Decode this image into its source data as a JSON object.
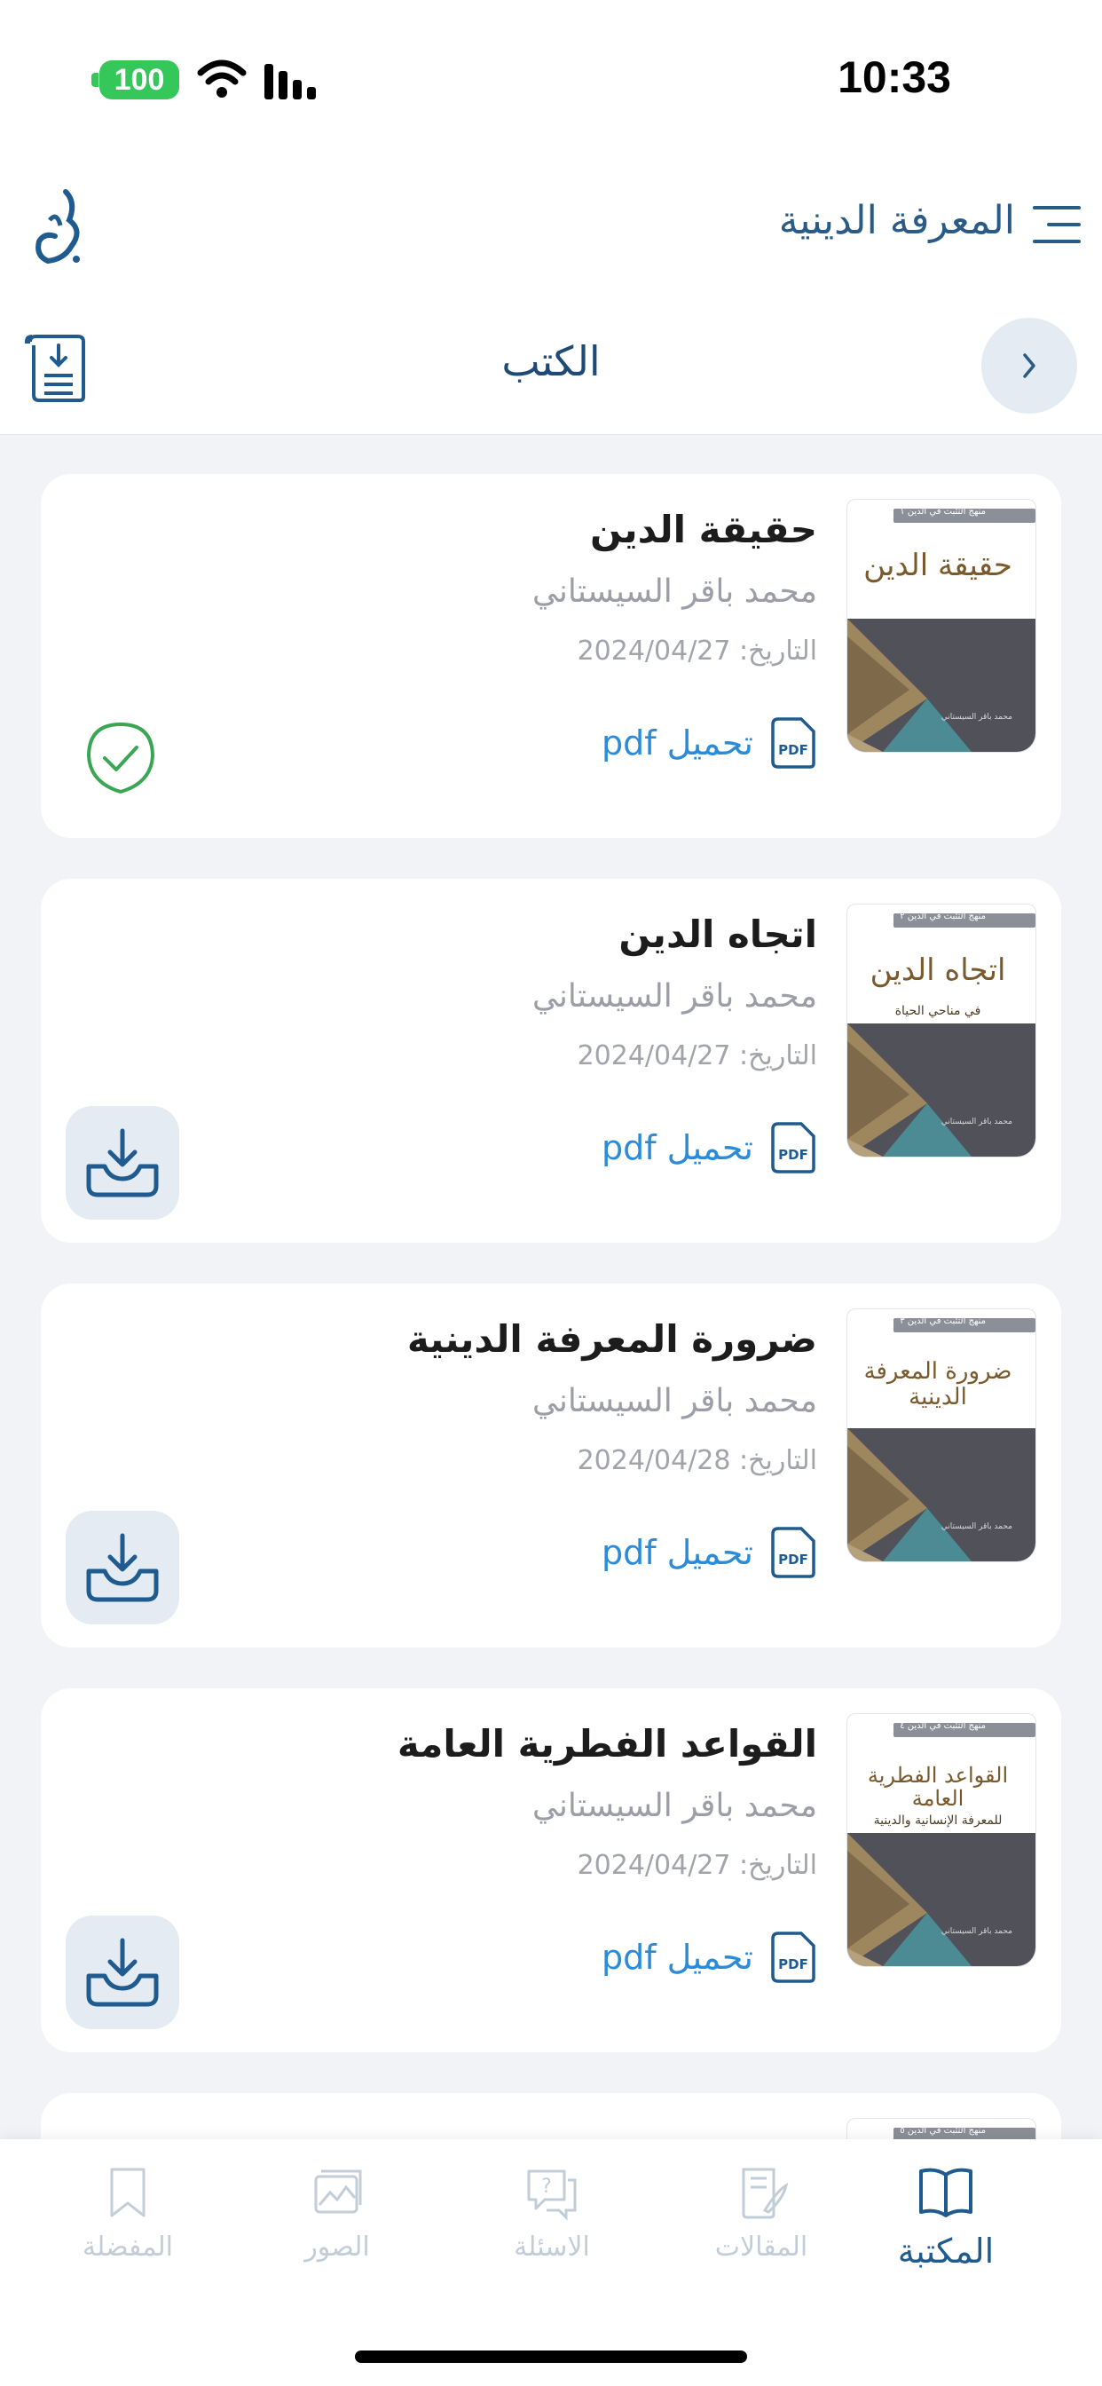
{
  "status_bar": {
    "battery": "100",
    "time": "10:33"
  },
  "header": {
    "app_title": "المعرفة الدينية",
    "section_title": "الكتب"
  },
  "books": [
    {
      "title": "حقيقة الدين",
      "author": "محمد باقر السيستاني",
      "date": "التاريخ: 2024/04/27",
      "pdf_label": "تحميل pdf",
      "cover_title": "حقيقة الدين",
      "cover_subtitle": "",
      "cover_tag": "منهج التثبت في الدين ١",
      "cover_author": "محمد باقر السيستاني",
      "downloaded": true
    },
    {
      "title": "اتجاه الدين",
      "author": "محمد باقر السيستاني",
      "date": "التاريخ: 2024/04/27",
      "pdf_label": "تحميل pdf",
      "cover_title": "اتجاه الدين",
      "cover_subtitle": "في مناحي الحياة",
      "cover_tag": "منهج التثبت في الدين ٢",
      "cover_author": "محمد باقر السيستاني",
      "downloaded": false
    },
    {
      "title": "ضرورة المعرفة الدينية",
      "author": "محمد باقر السيستاني",
      "date": "التاريخ: 2024/04/28",
      "pdf_label": "تحميل pdf",
      "cover_title": "ضرورة المعرفة الدينية",
      "cover_subtitle": "",
      "cover_tag": "منهج التثبت في الدين ٣",
      "cover_author": "محمد باقر السيستاني",
      "downloaded": false
    },
    {
      "title": "القواعد الفطرية العامة",
      "author": "محمد باقر السيستاني",
      "date": "التاريخ: 2024/04/27",
      "pdf_label": "تحميل pdf",
      "cover_title": "القواعد الفطرية العامة",
      "cover_subtitle": "للمعرفة الإنسانية والدينية",
      "cover_tag": "منهج التثبت في الدين ٤",
      "cover_author": "محمد باقر السيستاني",
      "downloaded": false
    },
    {
      "title": "",
      "author": "",
      "date": "",
      "pdf_label": "",
      "cover_title": "",
      "cover_subtitle": "",
      "cover_tag": "منهج التثبت في الدين ٥",
      "cover_author": "",
      "downloaded": false
    }
  ],
  "tabs": [
    {
      "label": "المكتبة",
      "icon": "book-open-icon",
      "active": true
    },
    {
      "label": "المقالات",
      "icon": "articles-icon",
      "active": false
    },
    {
      "label": "الاسئلة",
      "icon": "questions-icon",
      "active": false
    },
    {
      "label": "الصور",
      "icon": "images-icon",
      "active": false
    },
    {
      "label": "المفضلة",
      "icon": "bookmark-icon",
      "active": false
    }
  ],
  "colors": {
    "primary": "#1f5b8f",
    "link": "#2a8bd8",
    "success": "#35c759",
    "background": "#f2f3f6",
    "inactive_tab": "#c3cdd8"
  }
}
